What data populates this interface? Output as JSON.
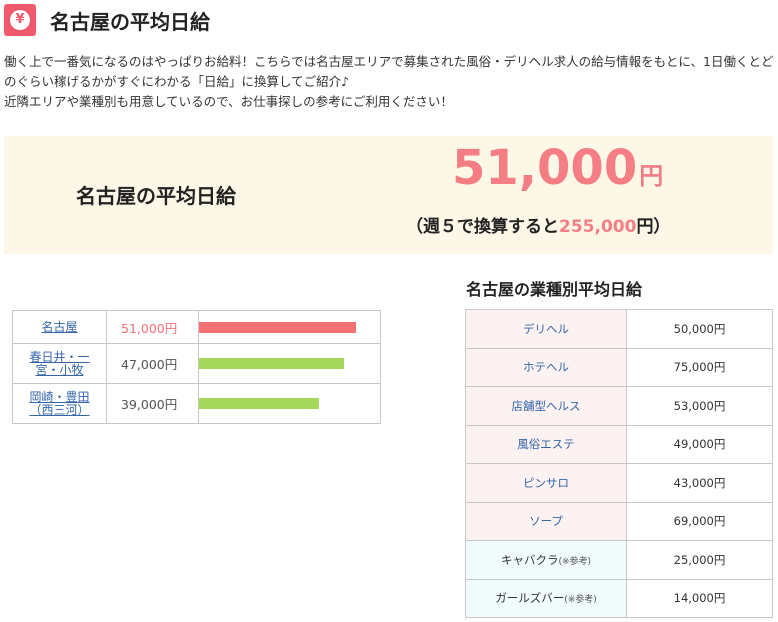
{
  "header": {
    "icon_glyph": "¥",
    "title": "名古屋の平均日給"
  },
  "intro": {
    "line1": "働く上で一番気になるのはやっぱりお給料！こちらでは名古屋エリアで募集された風俗・デリヘル求人の給与情報をもとに、1日働くとどのぐらい稼げるかがすぐにわかる「日給」に換算してご紹介♪",
    "line2": "近隣エリアや業種別も用意しているので、お仕事探しの参考にご利用ください！"
  },
  "summary": {
    "label": "名古屋の平均日給",
    "value": "51,000",
    "unit": "円",
    "weekly_prefix": "（週５で換算すると",
    "weekly_value": "255,000",
    "weekly_suffix": "円）"
  },
  "areas": [
    {
      "name": "名古屋",
      "value": "51,000円",
      "amount": 51000,
      "highlight": true
    },
    {
      "name": "春日井・一宮・小牧",
      "value": "47,000円",
      "amount": 47000,
      "highlight": false
    },
    {
      "name": "岡崎・豊田（西三河）",
      "value": "39,000円",
      "amount": 39000,
      "highlight": false
    }
  ],
  "types_section": {
    "title": "名古屋の業種別平均日給",
    "rows": [
      {
        "name": "デリヘル",
        "note": "",
        "value": "50,000円",
        "style": "pink"
      },
      {
        "name": "ホテヘル",
        "note": "",
        "value": "75,000円",
        "style": "pink"
      },
      {
        "name": "店舗型ヘルス",
        "note": "",
        "value": "53,000円",
        "style": "pink"
      },
      {
        "name": "風俗エステ",
        "note": "",
        "value": "49,000円",
        "style": "pink"
      },
      {
        "name": "ピンサロ",
        "note": "",
        "value": "43,000円",
        "style": "pink"
      },
      {
        "name": "ソープ",
        "note": "",
        "value": "69,000円",
        "style": "pink"
      },
      {
        "name": "キャバクラ",
        "note": "(※参考)",
        "value": "25,000円",
        "style": "mint"
      },
      {
        "name": "ガールズバー",
        "note": "(※参考)",
        "value": "14,000円",
        "style": "mint"
      }
    ]
  },
  "colors": {
    "accent_pink": "#ee5a6c",
    "value_pink": "#f57e84",
    "bar_top": "#f57073",
    "bar_other": "#a3d85c",
    "summary_bg": "#fdf7e8",
    "link_blue": "#3366aa"
  }
}
